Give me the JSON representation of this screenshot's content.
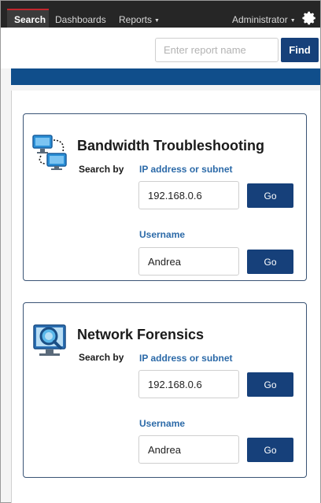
{
  "nav": {
    "tabs": [
      {
        "label": "Search",
        "active": true
      },
      {
        "label": "Dashboards",
        "active": false
      },
      {
        "label": "Reports",
        "has_dropdown": true
      },
      {
        "label": "Administrator",
        "has_dropdown": true
      }
    ],
    "settings_icon": "gear-icon"
  },
  "search": {
    "placeholder": "Enter report name",
    "value": "",
    "find_label": "Find"
  },
  "colors": {
    "nav_bg": "#262626",
    "active_accent": "#c1272d",
    "primary": "#16407a",
    "banner": "#104e8b",
    "field_label": "#2c6aa8"
  },
  "cards": [
    {
      "icon": "bandwidth-monitors-icon",
      "title": "Bandwidth Troubleshooting",
      "search_by": "Search by",
      "ip_label": "IP address or subnet",
      "ip_value": "192.168.0.6",
      "username_label": "Username",
      "username_value": "Andrea",
      "go_label": "Go"
    },
    {
      "icon": "forensics-magnifier-icon",
      "title": "Network Forensics",
      "search_by": "Search by",
      "ip_label": "IP address or subnet",
      "ip_value": "192.168.0.6",
      "username_label": "Username",
      "username_value": "Andrea",
      "go_label": "Go"
    }
  ]
}
